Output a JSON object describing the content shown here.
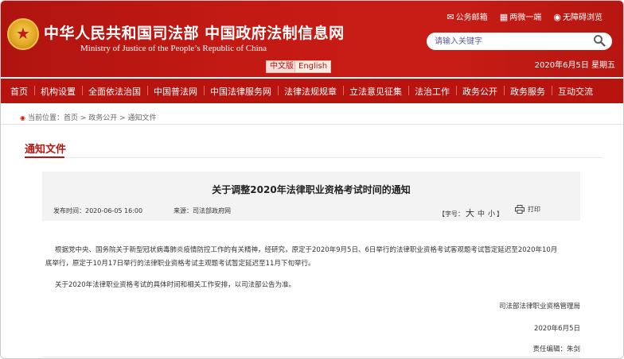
{
  "header": {
    "title": "中华人民共和国司法部  中国政府法制信息网",
    "subtitle": "Ministry of Justice of the People’s Republic of China",
    "lang_zh": "中文版",
    "lang_en": "English",
    "links": {
      "mail": "公务邮箱",
      "two_micro": "两微一端",
      "accessible": "无障碍浏览"
    },
    "search_placeholder": "请输入关键字",
    "date": "2020年6月5日 星期五"
  },
  "nav": {
    "items": [
      "首页",
      "机构设置",
      "全面依法治国",
      "中国普法网",
      "中国法律服务网",
      "法律法规规章",
      "立法意见征集",
      "法治工作",
      "政务公开",
      "政务服务",
      "互动交流"
    ]
  },
  "breadcrumb": "当前位置：首页 > 政务公开 > 通知文件",
  "section_title": "通知文件",
  "article": {
    "title": "关于调整2020年法律职业资格考试时间的通知",
    "time_label": "发布时间：",
    "time": "2020-06-05 16:00",
    "source_label": "来源：",
    "source": "司法部政府网",
    "font_label": "【字号：",
    "font_big": "大",
    "font_mid": "中",
    "font_small": "小",
    "font_end": "】",
    "print": "打印",
    "para1_line1": "根据党中央、国务院关于新型冠状病毒肺炎疫情防控工作的有关精神，经研究，原定于2020年9月5日、6日举行的法律职业资格考试客观题考试暂定延迟至2020年10月",
    "para1_line2": "底举行，原定于10月17日举行的法律职业资格考试主观题考试暂定延迟至11月下旬举行。",
    "para2": "关于2020年法律职业资格考试的具体时间和相关工作安排，以司法部公告为准。",
    "signature": "司法部法律职业资格管理局",
    "sign_date": "2020年6月5日",
    "editor": "责任编辑：朱剑"
  },
  "colors": {
    "brand_red": "#c41a14",
    "nav_red": "#b8140f"
  }
}
